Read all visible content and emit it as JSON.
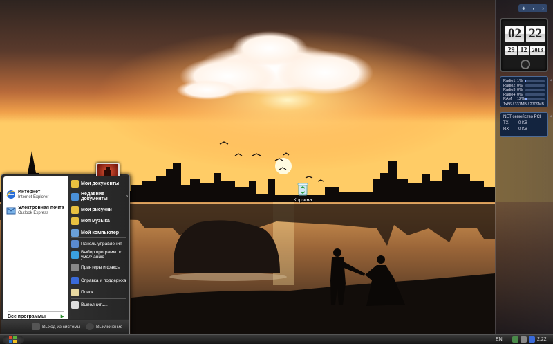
{
  "desktop": {
    "icons": [
      {
        "label": "Корзина",
        "icon": "recycle-bin-icon"
      }
    ]
  },
  "sidebar": {
    "top_buttons": [
      "+",
      "‹",
      "›"
    ],
    "clock": {
      "hour": "02",
      "minute": "22",
      "day": "29",
      "month": "12",
      "year": "2013"
    },
    "drives": [
      {
        "name": "Radio1",
        "percent": "1%",
        "fill": 0.01
      },
      {
        "name": "Radio2",
        "percent": "0%",
        "fill": 0.0
      },
      {
        "name": "Radio3",
        "percent": "0%",
        "fill": 0.0
      },
      {
        "name": "Radio4",
        "percent": "0%",
        "fill": 0.0
      },
      {
        "name": "RAM",
        "percent": "12%",
        "fill": 0.12
      }
    ],
    "drives_footer": "1x86 / 331MB / 2709MB",
    "network": {
      "title": "NET семейство PCI",
      "rows": [
        {
          "label": "TX",
          "value": "0 KB"
        },
        {
          "label": "RX",
          "value": "0 KB"
        }
      ]
    }
  },
  "start_menu": {
    "pinned": [
      {
        "title": "Интернет",
        "subtitle": "Internet Explorer",
        "icon": "internet-explorer-icon"
      },
      {
        "title": "Электронная почта",
        "subtitle": "Outlook Express",
        "icon": "outlook-express-icon"
      }
    ],
    "all_programs": "Все программы",
    "right_items": [
      {
        "label": "Мои документы",
        "bold": true,
        "icon": "my-documents-icon"
      },
      {
        "label": "Недавние документы",
        "bold": true,
        "icon": "recent-documents-icon",
        "submenu": "›"
      },
      {
        "label": "Мои рисунки",
        "bold": true,
        "icon": "my-pictures-icon"
      },
      {
        "label": "Моя музыка",
        "bold": true,
        "icon": "my-music-icon"
      },
      {
        "label": "Мой компьютер",
        "bold": true,
        "icon": "my-computer-icon"
      },
      {
        "label": "Панель управления",
        "bold": false,
        "icon": "control-panel-icon"
      },
      {
        "label": "Выбор программ по умолчанию",
        "bold": false,
        "icon": "default-programs-icon"
      },
      {
        "label": "Принтеры и факсы",
        "bold": false,
        "icon": "printers-icon"
      },
      {
        "label": "Справка и поддержка",
        "bold": false,
        "icon": "help-icon"
      },
      {
        "label": "Поиск",
        "bold": false,
        "icon": "search-icon"
      },
      {
        "label": "Выполнить...",
        "bold": false,
        "icon": "run-icon"
      }
    ],
    "logoff": "Выход из системы",
    "shutdown": "Выключение"
  },
  "taskbar": {
    "language": "EN",
    "time": "2:22"
  },
  "colors": {
    "accent": "#31476b",
    "start_menu_bg": "#2a2a2a",
    "sky_top": "#3a2a22",
    "sun": "#ffd27a"
  }
}
